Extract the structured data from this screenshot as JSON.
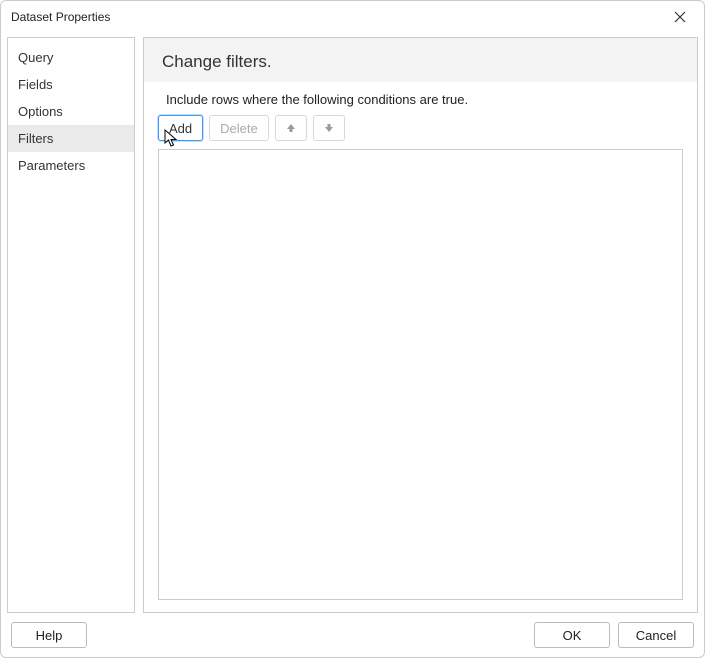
{
  "window": {
    "title": "Dataset Properties"
  },
  "sidebar": {
    "items": [
      {
        "label": "Query",
        "selected": false
      },
      {
        "label": "Fields",
        "selected": false
      },
      {
        "label": "Options",
        "selected": false
      },
      {
        "label": "Filters",
        "selected": true
      },
      {
        "label": "Parameters",
        "selected": false
      }
    ]
  },
  "main": {
    "heading": "Change filters.",
    "instruction": "Include rows where the following conditions are true.",
    "toolbar": {
      "add": "Add",
      "delete": "Delete"
    }
  },
  "footer": {
    "help": "Help",
    "ok": "OK",
    "cancel": "Cancel"
  }
}
